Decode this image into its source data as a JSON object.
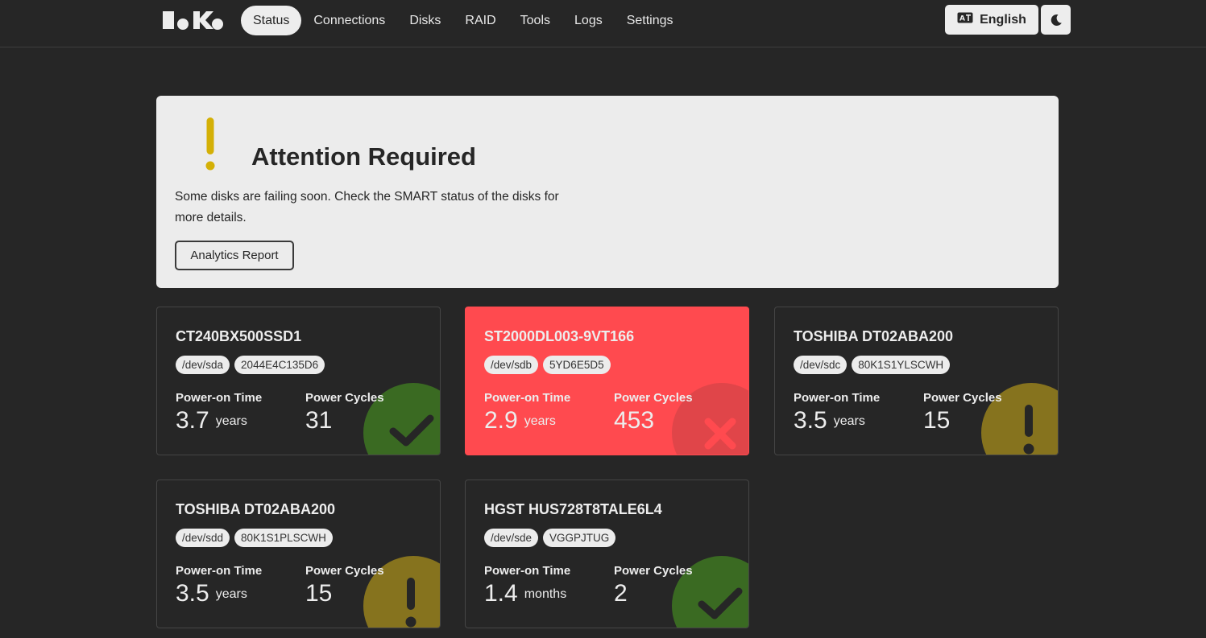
{
  "nav": {
    "items": [
      {
        "label": "Status",
        "active": true
      },
      {
        "label": "Connections",
        "active": false
      },
      {
        "label": "Disks",
        "active": false
      },
      {
        "label": "RAID",
        "active": false
      },
      {
        "label": "Tools",
        "active": false
      },
      {
        "label": "Logs",
        "active": false
      },
      {
        "label": "Settings",
        "active": false
      }
    ],
    "language_label": "English"
  },
  "alert": {
    "title": "Attention Required",
    "message": "Some disks are failing soon. Check the SMART status of the disks for more details.",
    "button_label": "Analytics Report",
    "icon": "exclamation-icon",
    "icon_color": "#d4b006"
  },
  "labels": {
    "power_on_time": "Power-on Time",
    "power_cycles": "Power Cycles"
  },
  "disks": [
    {
      "model": "CT240BX500SSD1",
      "device": "/dev/sda",
      "serial": "2044E4C135D6",
      "power_on_value": "3.7",
      "power_on_unit": "years",
      "power_cycles": "31",
      "status": "healthy",
      "status_icon": "check-icon"
    },
    {
      "model": "ST2000DL003-9VT166",
      "device": "/dev/sdb",
      "serial": "5YD6E5D5",
      "power_on_value": "2.9",
      "power_on_unit": "years",
      "power_cycles": "453",
      "status": "failing",
      "status_icon": "x-icon"
    },
    {
      "model": "TOSHIBA DT02ABA200",
      "device": "/dev/sdc",
      "serial": "80K1S1YLSCWH",
      "power_on_value": "3.5",
      "power_on_unit": "years",
      "power_cycles": "15",
      "status": "warning",
      "status_icon": "exclamation-icon"
    },
    {
      "model": "TOSHIBA DT02ABA200",
      "device": "/dev/sdd",
      "serial": "80K1S1PLSCWH",
      "power_on_value": "3.5",
      "power_on_unit": "years",
      "power_cycles": "15",
      "status": "warning",
      "status_icon": "exclamation-icon"
    },
    {
      "model": "HGST HUS728T8TALE6L4",
      "device": "/dev/sde",
      "serial": "VGGPJTUG",
      "power_on_value": "1.4",
      "power_on_unit": "months",
      "power_cycles": "2",
      "status": "healthy",
      "status_icon": "check-icon"
    }
  ],
  "colors": {
    "background": "#262626",
    "healthy": "#3a6a22",
    "warning": "#86731e",
    "failing_card": "#ff4a4f",
    "failing_circle": "#e04549",
    "failing_glyph": "#ff4a4f"
  }
}
